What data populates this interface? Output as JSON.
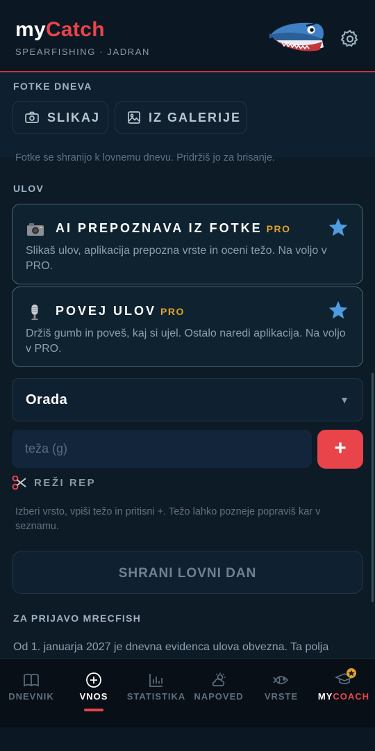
{
  "header": {
    "brand_my": "my",
    "brand_catch": "Catch",
    "tagline": "SPEARFISHING · JADRAN",
    "mascot_icon": "shark-mascot-icon",
    "settings_icon": "gear-icon"
  },
  "photos": {
    "section_label": "FOTKE DNEVA",
    "take_photo_label": "SLIKAJ",
    "gallery_label": "IZ GALERIJE",
    "hint": "Fotke se shranijo k lovnemu dnevu. Pridržiš jo za brisanje."
  },
  "catch": {
    "section_label": "ULOV",
    "ai_card": {
      "title": "AI PREPOZNAVA IZ FOTKE",
      "badge": "PRO",
      "description": "Slikaš ulov, aplikacija prepozna vrste in oceni težo. Na voljo v PRO."
    },
    "voice_card": {
      "title": "POVEJ ULOV",
      "badge": "PRO",
      "description": "Držiš gumb in poveš, kaj si ujel. Ostalo naredi aplikacija. Na voljo v PRO."
    },
    "species_selected": "Orada",
    "species_caret": "▼",
    "weight_placeholder": "teža (g)",
    "add_button": "+",
    "cut_tail_label": "REŽI REP",
    "hint": "Izberi vrsto, vpiši težo in pritisni +. Težo lahko pozneje popraviš kar v seznamu.",
    "save_label": "SHRANI LOVNI DAN"
  },
  "mrecfish": {
    "section_label": "ZA PRIJAVO MRECFISH",
    "text": "Od 1. januarja 2027 je dnevna evidenca ulova obvezna. Ta polja"
  },
  "nav": {
    "items": [
      {
        "label": "DNEVNIK",
        "icon": "book-icon"
      },
      {
        "label": "VNOS",
        "icon": "plus-circle-icon"
      },
      {
        "label": "STATISTIKA",
        "icon": "bar-chart-icon"
      },
      {
        "label": "NAPOVED",
        "icon": "weather-icon"
      },
      {
        "label": "VRSTE",
        "icon": "fish-icon"
      }
    ],
    "coach_my": "MY",
    "coach_coach": "COACH",
    "active": "VNOS"
  },
  "colors": {
    "accent_red": "#e8444a",
    "pro_gold": "#e2a42b",
    "star_blue": "#4f9be0",
    "background": "#0d1b27"
  }
}
